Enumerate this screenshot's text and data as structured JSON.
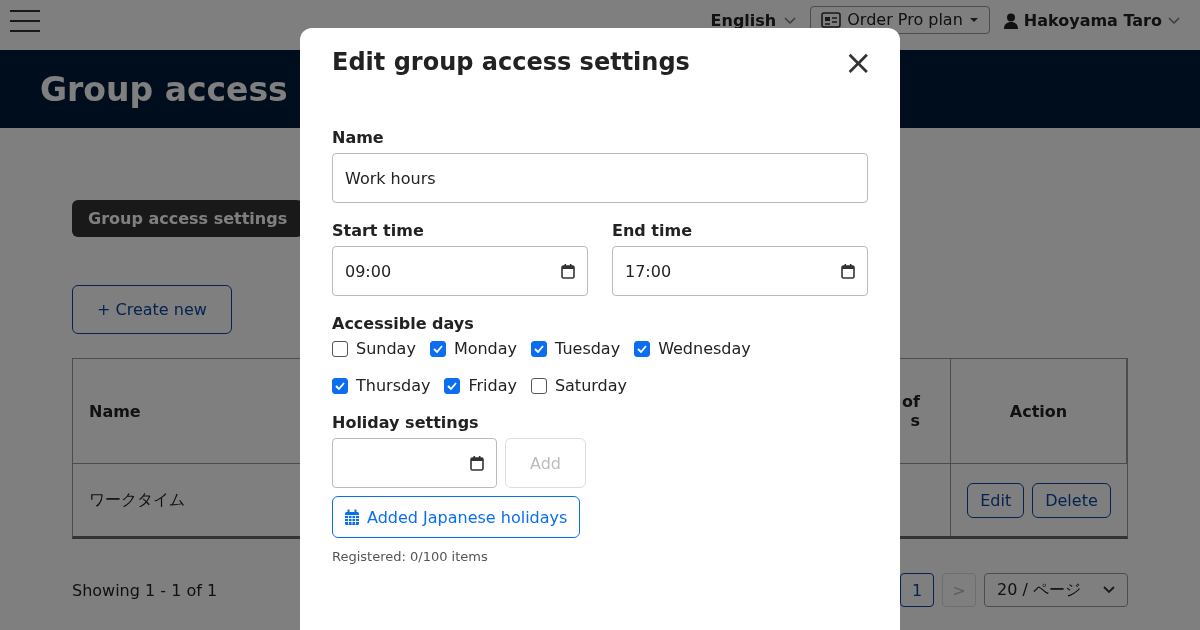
{
  "topbar": {
    "language": "English",
    "plan_button": "Order Pro plan",
    "user": "Hakoyama Taro"
  },
  "page_title": "Group access",
  "tabs": [
    {
      "label": "Group access settings",
      "selected": true
    }
  ],
  "create_button": "+ Create new",
  "table": {
    "columns": [
      {
        "label": "Name"
      },
      {
        "lines": [
          "of",
          "s"
        ]
      },
      {
        "label": "Action"
      }
    ],
    "rows": [
      {
        "name": "ワークタイム",
        "actions": [
          "Edit",
          "Delete"
        ]
      }
    ]
  },
  "footer": {
    "showing": "Showing 1 - 1 of 1",
    "pages": [
      {
        "label": "1",
        "selected": true
      }
    ],
    "next": {
      "label": ">",
      "disabled": true
    },
    "page_size": "20 / ページ"
  },
  "modal": {
    "title": "Edit group access settings",
    "close": "×",
    "name": {
      "label": "Name",
      "value": "Work hours"
    },
    "start_time": {
      "label": "Start time",
      "value": "09:00"
    },
    "end_time": {
      "label": "End time",
      "value": "17:00"
    },
    "days_label": "Accessible days",
    "days": [
      {
        "label": "Sunday",
        "checked": false
      },
      {
        "label": "Monday",
        "checked": true
      },
      {
        "label": "Tuesday",
        "checked": true
      },
      {
        "label": "Wednesday",
        "checked": true
      },
      {
        "label": "Thursday",
        "checked": true
      },
      {
        "label": "Friday",
        "checked": true
      },
      {
        "label": "Saturday",
        "checked": false
      }
    ],
    "holiday_label": "Holiday settings",
    "add_button": {
      "label": "Add",
      "disabled": true
    },
    "japanese_holidays_button": "Added Japanese holidays",
    "registered": "Registered: 0/100 items"
  }
}
